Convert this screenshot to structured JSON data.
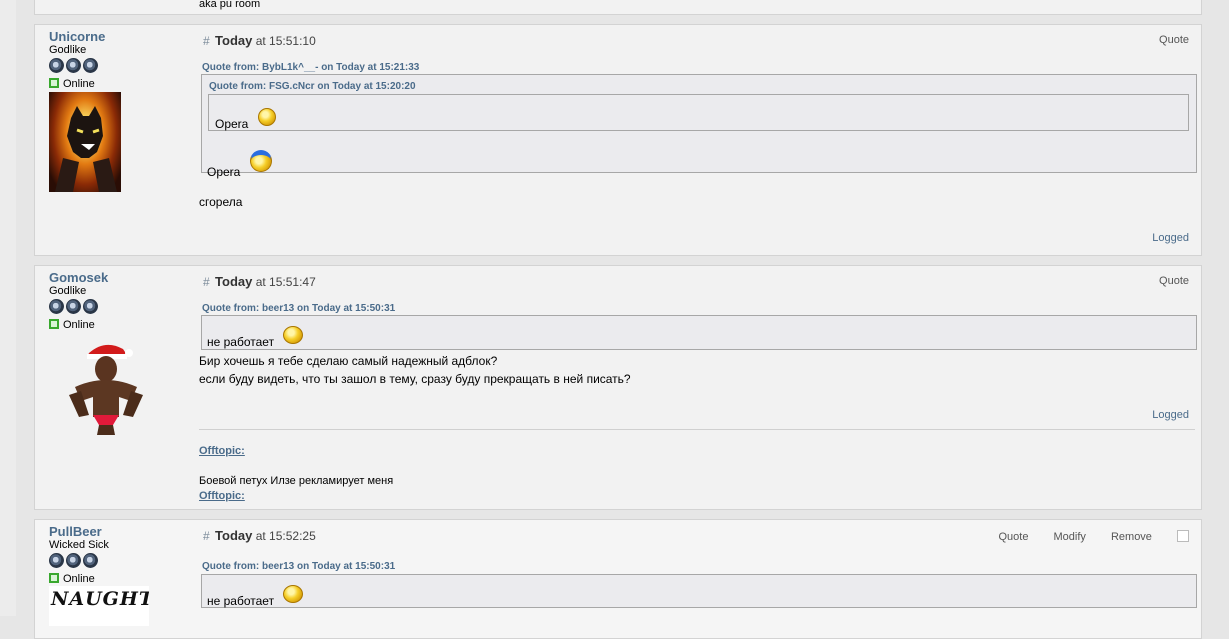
{
  "top_snippet": "aka pu room",
  "posts": [
    {
      "author": "Unicorne",
      "rank": "Godlike",
      "status": "Online",
      "header_hash": "#",
      "header_day": "Today",
      "header_time": "at 15:51:10",
      "actions": [
        "Quote"
      ],
      "quote_outer_header": "Quote from: BybL1k^__- on Today at 15:21:33",
      "quote_inner_header": "Quote from: FSG.cNcr on Today at 15:20:20",
      "quote_inner_text": "Opera",
      "quote_outer_text": "Opera",
      "body": "сгорела",
      "footer": "Logged"
    },
    {
      "author": "Gomosek",
      "rank": "Godlike",
      "status": "Online",
      "header_hash": "#",
      "header_day": "Today",
      "header_time": "at 15:51:47",
      "actions": [
        "Quote"
      ],
      "quote_header": "Quote from: beer13 on Today at 15:50:31",
      "quote_text": "не работает",
      "body_lines": [
        "Бир хочешь я тебе сделаю самый надежный адблок?",
        "если буду видеть, что ты зашол в тему, сразу буду прекращать в ней писать?"
      ],
      "footer": "Logged",
      "signature_label": "Offtopic:",
      "signature_text": "Боевой петух Илзе рекламирует меня",
      "signature_label_end": "Offtopic:"
    },
    {
      "author": "PullBeer",
      "rank": "Wicked Sick",
      "status": "Online",
      "header_hash": "#",
      "header_day": "Today",
      "header_time": "at 15:52:25",
      "actions": [
        "Quote",
        "Modify",
        "Remove"
      ],
      "quote_header": "Quote from: beer13 on Today at 15:50:31",
      "quote_text": "не работает",
      "avatar_text": "NAUGHT"
    }
  ]
}
